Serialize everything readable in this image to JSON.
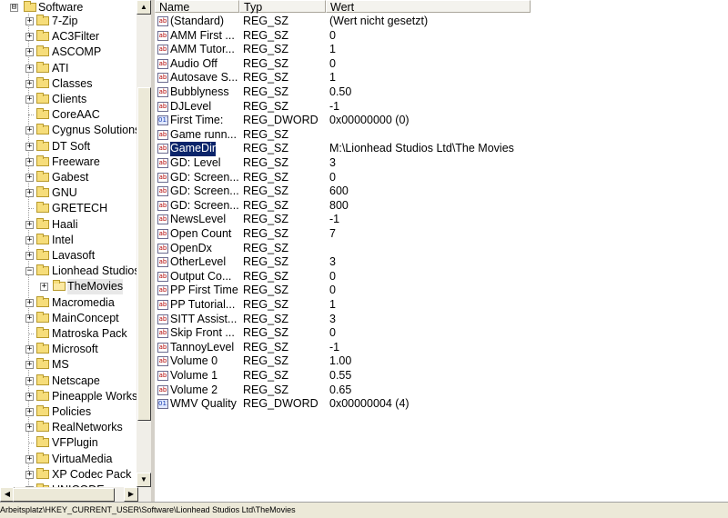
{
  "tree": {
    "root": {
      "label": "Software",
      "expander": "⊟"
    },
    "items": [
      {
        "label": "7-Zip",
        "expander": "+"
      },
      {
        "label": "AC3Filter",
        "expander": "+"
      },
      {
        "label": "ASCOMP",
        "expander": "+"
      },
      {
        "label": "ATI",
        "expander": "+"
      },
      {
        "label": "Classes",
        "expander": "+"
      },
      {
        "label": "Clients",
        "expander": "+"
      },
      {
        "label": "CoreAAC",
        "expander": ""
      },
      {
        "label": "Cygnus Solutions",
        "expander": "+"
      },
      {
        "label": "DT Soft",
        "expander": "+"
      },
      {
        "label": "Freeware",
        "expander": "+"
      },
      {
        "label": "Gabest",
        "expander": "+"
      },
      {
        "label": "GNU",
        "expander": "+"
      },
      {
        "label": "GRETECH",
        "expander": ""
      },
      {
        "label": "Haali",
        "expander": "+"
      },
      {
        "label": "Intel",
        "expander": "+"
      },
      {
        "label": "Lavasoft",
        "expander": "+"
      },
      {
        "label": "Lionhead Studios",
        "expander": "−"
      },
      {
        "label": "TheMovies",
        "expander": "+",
        "child": true,
        "selected": true
      },
      {
        "label": "Macromedia",
        "expander": "+"
      },
      {
        "label": "MainConcept",
        "expander": "+"
      },
      {
        "label": "Matroska Pack",
        "expander": ""
      },
      {
        "label": "Microsoft",
        "expander": "+"
      },
      {
        "label": "MS",
        "expander": "+"
      },
      {
        "label": "Netscape",
        "expander": "+"
      },
      {
        "label": "Pineapple Works",
        "expander": "+"
      },
      {
        "label": "Policies",
        "expander": "+"
      },
      {
        "label": "RealNetworks",
        "expander": "+"
      },
      {
        "label": "VFPlugin",
        "expander": ""
      },
      {
        "label": "VirtuaMedia",
        "expander": "+"
      },
      {
        "label": "XP Codec Pack",
        "expander": "+"
      },
      {
        "label": "UNICODE ...",
        "expander": "+"
      }
    ]
  },
  "columns": {
    "name": "Name",
    "type": "Typ",
    "value": "Wert"
  },
  "rows": [
    {
      "name": "(Standard)",
      "type": "REG_SZ",
      "value": "(Wert nicht gesetzt)",
      "icon": "ab"
    },
    {
      "name": "AMM First ...",
      "type": "REG_SZ",
      "value": "0",
      "icon": "ab"
    },
    {
      "name": "AMM Tutor...",
      "type": "REG_SZ",
      "value": "1",
      "icon": "ab"
    },
    {
      "name": "Audio Off",
      "type": "REG_SZ",
      "value": "0",
      "icon": "ab"
    },
    {
      "name": "Autosave S...",
      "type": "REG_SZ",
      "value": "1",
      "icon": "ab"
    },
    {
      "name": "Bubblyness",
      "type": "REG_SZ",
      "value": "0.50",
      "icon": "ab"
    },
    {
      "name": "DJLevel",
      "type": "REG_SZ",
      "value": "-1",
      "icon": "ab"
    },
    {
      "name": "First Time:",
      "type": "REG_DWORD",
      "value": "0x00000000 (0)",
      "icon": "dword"
    },
    {
      "name": "Game runn...",
      "type": "REG_SZ",
      "value": "",
      "icon": "ab"
    },
    {
      "name": "GameDir",
      "type": "REG_SZ",
      "value": "M:\\Lionhead Studios Ltd\\The Movies",
      "icon": "ab",
      "selected": true
    },
    {
      "name": "GD: Level",
      "type": "REG_SZ",
      "value": "3",
      "icon": "ab"
    },
    {
      "name": "GD: Screen...",
      "type": "REG_SZ",
      "value": "0",
      "icon": "ab"
    },
    {
      "name": "GD: Screen...",
      "type": "REG_SZ",
      "value": "600",
      "icon": "ab"
    },
    {
      "name": "GD: Screen...",
      "type": "REG_SZ",
      "value": "800",
      "icon": "ab"
    },
    {
      "name": "NewsLevel",
      "type": "REG_SZ",
      "value": "-1",
      "icon": "ab"
    },
    {
      "name": "Open Count",
      "type": "REG_SZ",
      "value": "7",
      "icon": "ab"
    },
    {
      "name": "OpenDx",
      "type": "REG_SZ",
      "value": "",
      "icon": "ab"
    },
    {
      "name": "OtherLevel",
      "type": "REG_SZ",
      "value": "3",
      "icon": "ab"
    },
    {
      "name": "Output Co...",
      "type": "REG_SZ",
      "value": "0",
      "icon": "ab"
    },
    {
      "name": "PP First Time",
      "type": "REG_SZ",
      "value": "0",
      "icon": "ab"
    },
    {
      "name": "PP Tutorial...",
      "type": "REG_SZ",
      "value": "1",
      "icon": "ab"
    },
    {
      "name": "SITT Assist...",
      "type": "REG_SZ",
      "value": "3",
      "icon": "ab"
    },
    {
      "name": "Skip Front ...",
      "type": "REG_SZ",
      "value": "0",
      "icon": "ab"
    },
    {
      "name": "TannoyLevel",
      "type": "REG_SZ",
      "value": "-1",
      "icon": "ab"
    },
    {
      "name": "Volume 0",
      "type": "REG_SZ",
      "value": "1.00",
      "icon": "ab"
    },
    {
      "name": "Volume 1",
      "type": "REG_SZ",
      "value": "0.55",
      "icon": "ab"
    },
    {
      "name": "Volume 2",
      "type": "REG_SZ",
      "value": "0.65",
      "icon": "ab"
    },
    {
      "name": "WMV Quality",
      "type": "REG_DWORD",
      "value": "0x00000004 (4)",
      "icon": "dword"
    }
  ],
  "status": {
    "path": "Arbeitsplatz\\HKEY_CURRENT_USER\\Software\\Lionhead Studios Ltd\\TheMovies"
  },
  "scroll": {
    "up": "▲",
    "down": "▼",
    "left": "◀",
    "right": "▶"
  },
  "icons": {
    "string_value": "ab",
    "dword_value": "011"
  }
}
